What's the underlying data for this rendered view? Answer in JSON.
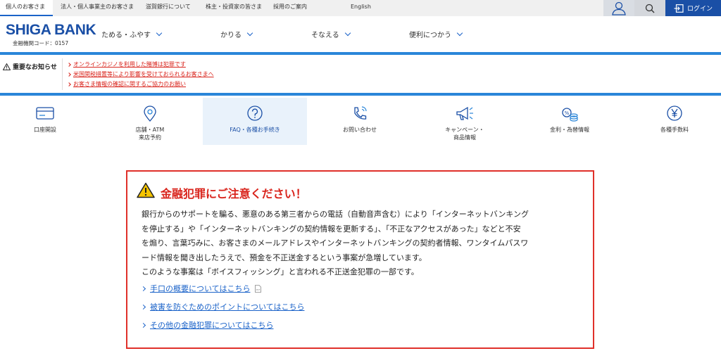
{
  "topbar": {
    "tabs": [
      "個人のお客さま",
      "法人・個人事業主のお客さま",
      "滋賀銀行について",
      "株主・投資家の皆さま",
      "採用のご案内",
      "English"
    ],
    "login_label": "ログイン"
  },
  "header": {
    "logo": "SHIGA BANK",
    "code": "金融機関コード：0157",
    "nav": [
      "ためる・ふやす",
      "かりる",
      "そなえる",
      "便利につかう"
    ]
  },
  "notice": {
    "heading": "重要なお知らせ",
    "links": [
      "オンラインカジノを利用した賭博は犯罪です",
      "米国関税措置等により影響を受けておられるお客さまへ",
      "お客さま情報の確認に関するご協力のお願い"
    ]
  },
  "iconbar": {
    "items": [
      {
        "label": "口座開設",
        "icon": "card-icon"
      },
      {
        "label": "店舗・ATM\n来店予約",
        "icon": "location-pin-icon"
      },
      {
        "label": "FAQ・各種お手続き",
        "icon": "question-icon"
      },
      {
        "label": "お問い合わせ",
        "icon": "phone-icon"
      },
      {
        "label": "キャンペーン・\n商品情報",
        "icon": "megaphone-icon"
      },
      {
        "label": "金利・為替情報",
        "icon": "coins-icon"
      },
      {
        "label": "各種手数料",
        "icon": "yen-icon"
      }
    ]
  },
  "alert": {
    "title": "金融犯罪にご注意ください！",
    "body": [
      "銀行からのサポートを騙る、悪意のある第三者からの電話（自動音声含む）により「インターネットバンキング",
      "を停止する」や「インターネットバンキングの契約情報を更新する」、「不正なアクセスがあった」などと不安",
      "を煽り、言葉巧みに、お客さまのメールアドレスやインターネットバンキングの契約者情報、ワンタイムパスワ",
      "ード情報を聞き出したうえで、預金を不正送金するという事案が急増しています。",
      "このような事案は「ボイスフィッシング」と言われる不正送金犯罪の一部です。"
    ],
    "links": [
      "手口の概要についてはこちら",
      "被害を防ぐためのポイントについてはこちら",
      "その他の金融犯罪についてはこちら"
    ],
    "pdf_label": "PDF"
  },
  "colors": {
    "brand": "#1a4fa6",
    "accent": "#2a86d9",
    "alert": "#e0302a"
  }
}
